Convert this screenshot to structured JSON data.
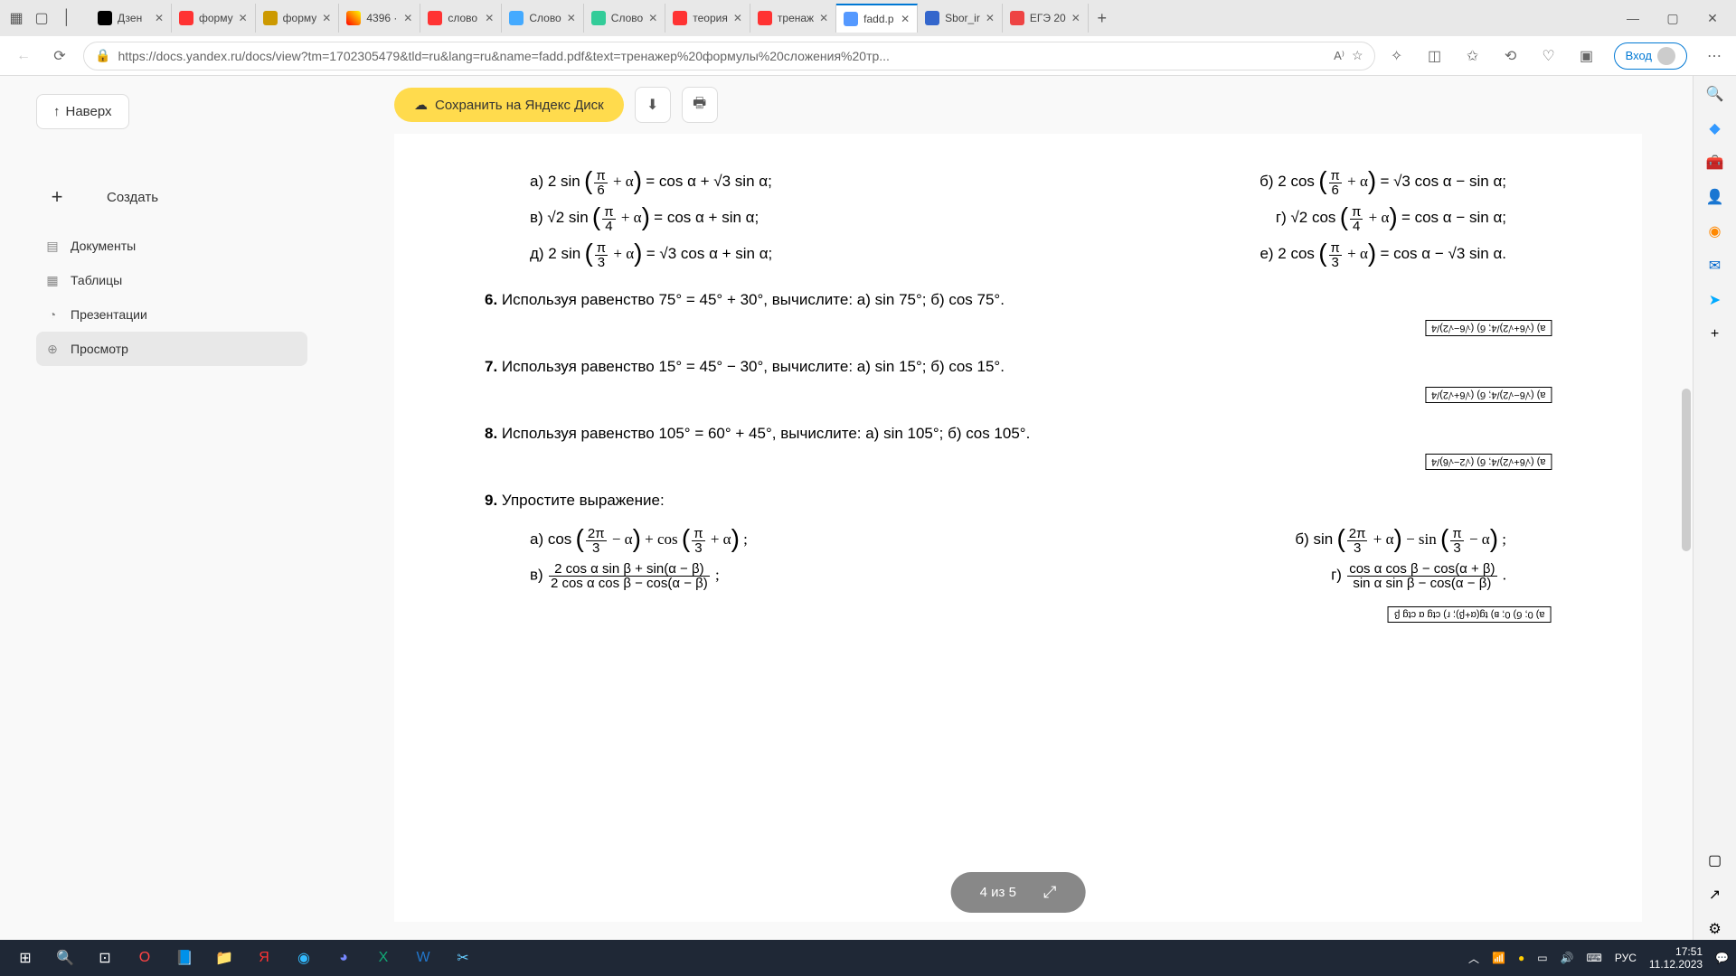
{
  "browser": {
    "tabs": [
      {
        "title": "Дзен"
      },
      {
        "title": "форму"
      },
      {
        "title": "форму"
      },
      {
        "title": "4396 ·"
      },
      {
        "title": "слово"
      },
      {
        "title": "Слово"
      },
      {
        "title": "Слово"
      },
      {
        "title": "теория"
      },
      {
        "title": "тренаж"
      },
      {
        "title": "fadd.p"
      },
      {
        "title": "Sbor_ir"
      },
      {
        "title": "ЕГЭ 20"
      }
    ],
    "url": "https://docs.yandex.ru/docs/view?tm=1702305479&tld=ru&lang=ru&name=fadd.pdf&text=тренажер%20формулы%20сложения%20тр...",
    "login": "Вход"
  },
  "sidebar": {
    "up": "Наверх",
    "create": "Создать",
    "items": [
      {
        "label": "Документы"
      },
      {
        "label": "Таблицы"
      },
      {
        "label": "Презентации"
      },
      {
        "label": "Просмотр"
      }
    ]
  },
  "toolbar": {
    "save": "Сохранить на Яндекс Диск"
  },
  "doc": {
    "eq5a": "а) 2 sin",
    "eq5a_r": "= cos α + √3 sin α;",
    "eq5b": "б) 2 cos",
    "eq5b_r": "= √3 cos α − sin α;",
    "eq5v": "в) √2 sin",
    "eq5v_r": "= cos α + sin α;",
    "eq5g": "г) √2 cos",
    "eq5g_r": "= cos α − sin α;",
    "eq5d": "д) 2 sin",
    "eq5d_r": "= √3 cos α + sin α;",
    "eq5e": "е) 2 cos",
    "eq5e_r": "= cos α − √3 sin α.",
    "t6": "6.",
    "t6_text": "Используя равенство 75° = 45° + 30°, вычислите: а) sin 75°; б) cos 75°.",
    "t7": "7.",
    "t7_text": "Используя равенство 15° = 45° − 30°, вычислите: а) sin 15°; б) cos 15°.",
    "t8": "8.",
    "t8_text": "Используя равенство 105° = 60° + 45°, вычислите: а) sin 105°; б) cos 105°.",
    "t9": "9.",
    "t9_text": "Упростите выражение:",
    "t9a": "а)  cos",
    "t9b": "б)  sin",
    "t9v": "в)",
    "t9g": "г)",
    "ans6": "а) (√6+√2)/4; б) (√6−√2)/4",
    "ans7": "а) (√6−√2)/4; б) (√6+√2)/4",
    "ans8": "а) (√6+√2)/4; б) (√2−√6)/4",
    "ans9": "а) 0; б) 0; в) tg(α+β); г) ctg α ctg β"
  },
  "pager": {
    "label": "4 из 5"
  },
  "system": {
    "lang": "РУС",
    "time": "17:51",
    "date": "11.12.2023"
  }
}
